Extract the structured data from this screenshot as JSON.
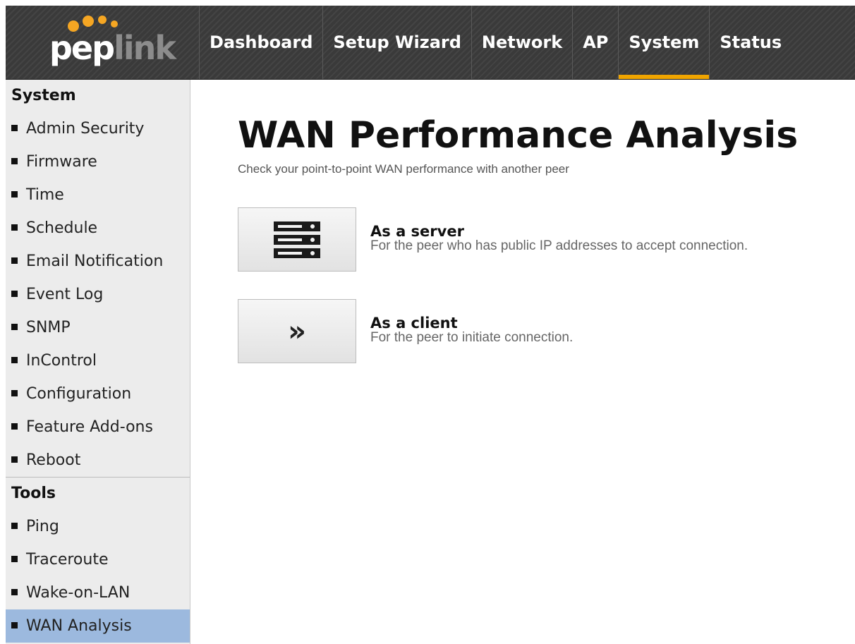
{
  "brand": {
    "logo_part1": "pep",
    "logo_part2": "link"
  },
  "nav": {
    "items": [
      {
        "label": "Dashboard"
      },
      {
        "label": "Setup Wizard"
      },
      {
        "label": "Network"
      },
      {
        "label": "AP"
      },
      {
        "label": "System",
        "active": true
      },
      {
        "label": "Status"
      }
    ]
  },
  "sidebar": {
    "system_heading": "System",
    "system_items": [
      {
        "label": "Admin Security"
      },
      {
        "label": "Firmware"
      },
      {
        "label": "Time"
      },
      {
        "label": "Schedule"
      },
      {
        "label": "Email Notification"
      },
      {
        "label": "Event Log"
      },
      {
        "label": "SNMP"
      },
      {
        "label": "InControl"
      },
      {
        "label": "Configuration"
      },
      {
        "label": "Feature Add-ons"
      },
      {
        "label": "Reboot"
      }
    ],
    "tools_heading": "Tools",
    "tools_items": [
      {
        "label": "Ping"
      },
      {
        "label": "Traceroute"
      },
      {
        "label": "Wake-on-LAN"
      },
      {
        "label": "WAN Analysis",
        "active": true
      }
    ]
  },
  "main": {
    "title": "WAN Performance Analysis",
    "subtitle": "Check your point-to-point WAN performance with another peer",
    "options": [
      {
        "icon": "server-icon",
        "title": "As a server",
        "desc": "For the peer who has public IP addresses to accept connection."
      },
      {
        "icon": "double-chevron-right-icon",
        "title": "As a client",
        "desc": "For the peer to initiate connection."
      }
    ]
  },
  "colors": {
    "accent": "#f0a500",
    "header_bg": "#3a3a3a",
    "sidebar_bg": "#ececec",
    "sidebar_active": "#9cb9de"
  }
}
